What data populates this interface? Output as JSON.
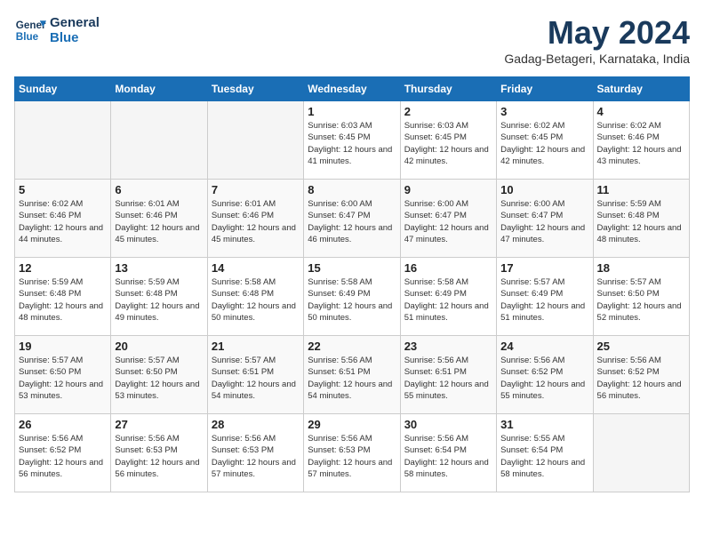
{
  "header": {
    "logo_line1": "General",
    "logo_line2": "Blue",
    "month_title": "May 2024",
    "location": "Gadag-Betageri, Karnataka, India"
  },
  "weekdays": [
    "Sunday",
    "Monday",
    "Tuesday",
    "Wednesday",
    "Thursday",
    "Friday",
    "Saturday"
  ],
  "weeks": [
    [
      {
        "day": "",
        "empty": true
      },
      {
        "day": "",
        "empty": true
      },
      {
        "day": "",
        "empty": true
      },
      {
        "day": "1",
        "sunrise": "6:03 AM",
        "sunset": "6:45 PM",
        "daylight": "12 hours and 41 minutes."
      },
      {
        "day": "2",
        "sunrise": "6:03 AM",
        "sunset": "6:45 PM",
        "daylight": "12 hours and 42 minutes."
      },
      {
        "day": "3",
        "sunrise": "6:02 AM",
        "sunset": "6:45 PM",
        "daylight": "12 hours and 42 minutes."
      },
      {
        "day": "4",
        "sunrise": "6:02 AM",
        "sunset": "6:46 PM",
        "daylight": "12 hours and 43 minutes."
      }
    ],
    [
      {
        "day": "5",
        "sunrise": "6:02 AM",
        "sunset": "6:46 PM",
        "daylight": "12 hours and 44 minutes."
      },
      {
        "day": "6",
        "sunrise": "6:01 AM",
        "sunset": "6:46 PM",
        "daylight": "12 hours and 45 minutes."
      },
      {
        "day": "7",
        "sunrise": "6:01 AM",
        "sunset": "6:46 PM",
        "daylight": "12 hours and 45 minutes."
      },
      {
        "day": "8",
        "sunrise": "6:00 AM",
        "sunset": "6:47 PM",
        "daylight": "12 hours and 46 minutes."
      },
      {
        "day": "9",
        "sunrise": "6:00 AM",
        "sunset": "6:47 PM",
        "daylight": "12 hours and 47 minutes."
      },
      {
        "day": "10",
        "sunrise": "6:00 AM",
        "sunset": "6:47 PM",
        "daylight": "12 hours and 47 minutes."
      },
      {
        "day": "11",
        "sunrise": "5:59 AM",
        "sunset": "6:48 PM",
        "daylight": "12 hours and 48 minutes."
      }
    ],
    [
      {
        "day": "12",
        "sunrise": "5:59 AM",
        "sunset": "6:48 PM",
        "daylight": "12 hours and 48 minutes."
      },
      {
        "day": "13",
        "sunrise": "5:59 AM",
        "sunset": "6:48 PM",
        "daylight": "12 hours and 49 minutes."
      },
      {
        "day": "14",
        "sunrise": "5:58 AM",
        "sunset": "6:48 PM",
        "daylight": "12 hours and 50 minutes."
      },
      {
        "day": "15",
        "sunrise": "5:58 AM",
        "sunset": "6:49 PM",
        "daylight": "12 hours and 50 minutes."
      },
      {
        "day": "16",
        "sunrise": "5:58 AM",
        "sunset": "6:49 PM",
        "daylight": "12 hours and 51 minutes."
      },
      {
        "day": "17",
        "sunrise": "5:57 AM",
        "sunset": "6:49 PM",
        "daylight": "12 hours and 51 minutes."
      },
      {
        "day": "18",
        "sunrise": "5:57 AM",
        "sunset": "6:50 PM",
        "daylight": "12 hours and 52 minutes."
      }
    ],
    [
      {
        "day": "19",
        "sunrise": "5:57 AM",
        "sunset": "6:50 PM",
        "daylight": "12 hours and 53 minutes."
      },
      {
        "day": "20",
        "sunrise": "5:57 AM",
        "sunset": "6:50 PM",
        "daylight": "12 hours and 53 minutes."
      },
      {
        "day": "21",
        "sunrise": "5:57 AM",
        "sunset": "6:51 PM",
        "daylight": "12 hours and 54 minutes."
      },
      {
        "day": "22",
        "sunrise": "5:56 AM",
        "sunset": "6:51 PM",
        "daylight": "12 hours and 54 minutes."
      },
      {
        "day": "23",
        "sunrise": "5:56 AM",
        "sunset": "6:51 PM",
        "daylight": "12 hours and 55 minutes."
      },
      {
        "day": "24",
        "sunrise": "5:56 AM",
        "sunset": "6:52 PM",
        "daylight": "12 hours and 55 minutes."
      },
      {
        "day": "25",
        "sunrise": "5:56 AM",
        "sunset": "6:52 PM",
        "daylight": "12 hours and 56 minutes."
      }
    ],
    [
      {
        "day": "26",
        "sunrise": "5:56 AM",
        "sunset": "6:52 PM",
        "daylight": "12 hours and 56 minutes."
      },
      {
        "day": "27",
        "sunrise": "5:56 AM",
        "sunset": "6:53 PM",
        "daylight": "12 hours and 56 minutes."
      },
      {
        "day": "28",
        "sunrise": "5:56 AM",
        "sunset": "6:53 PM",
        "daylight": "12 hours and 57 minutes."
      },
      {
        "day": "29",
        "sunrise": "5:56 AM",
        "sunset": "6:53 PM",
        "daylight": "12 hours and 57 minutes."
      },
      {
        "day": "30",
        "sunrise": "5:56 AM",
        "sunset": "6:54 PM",
        "daylight": "12 hours and 58 minutes."
      },
      {
        "day": "31",
        "sunrise": "5:55 AM",
        "sunset": "6:54 PM",
        "daylight": "12 hours and 58 minutes."
      },
      {
        "day": "",
        "empty": true
      }
    ]
  ]
}
